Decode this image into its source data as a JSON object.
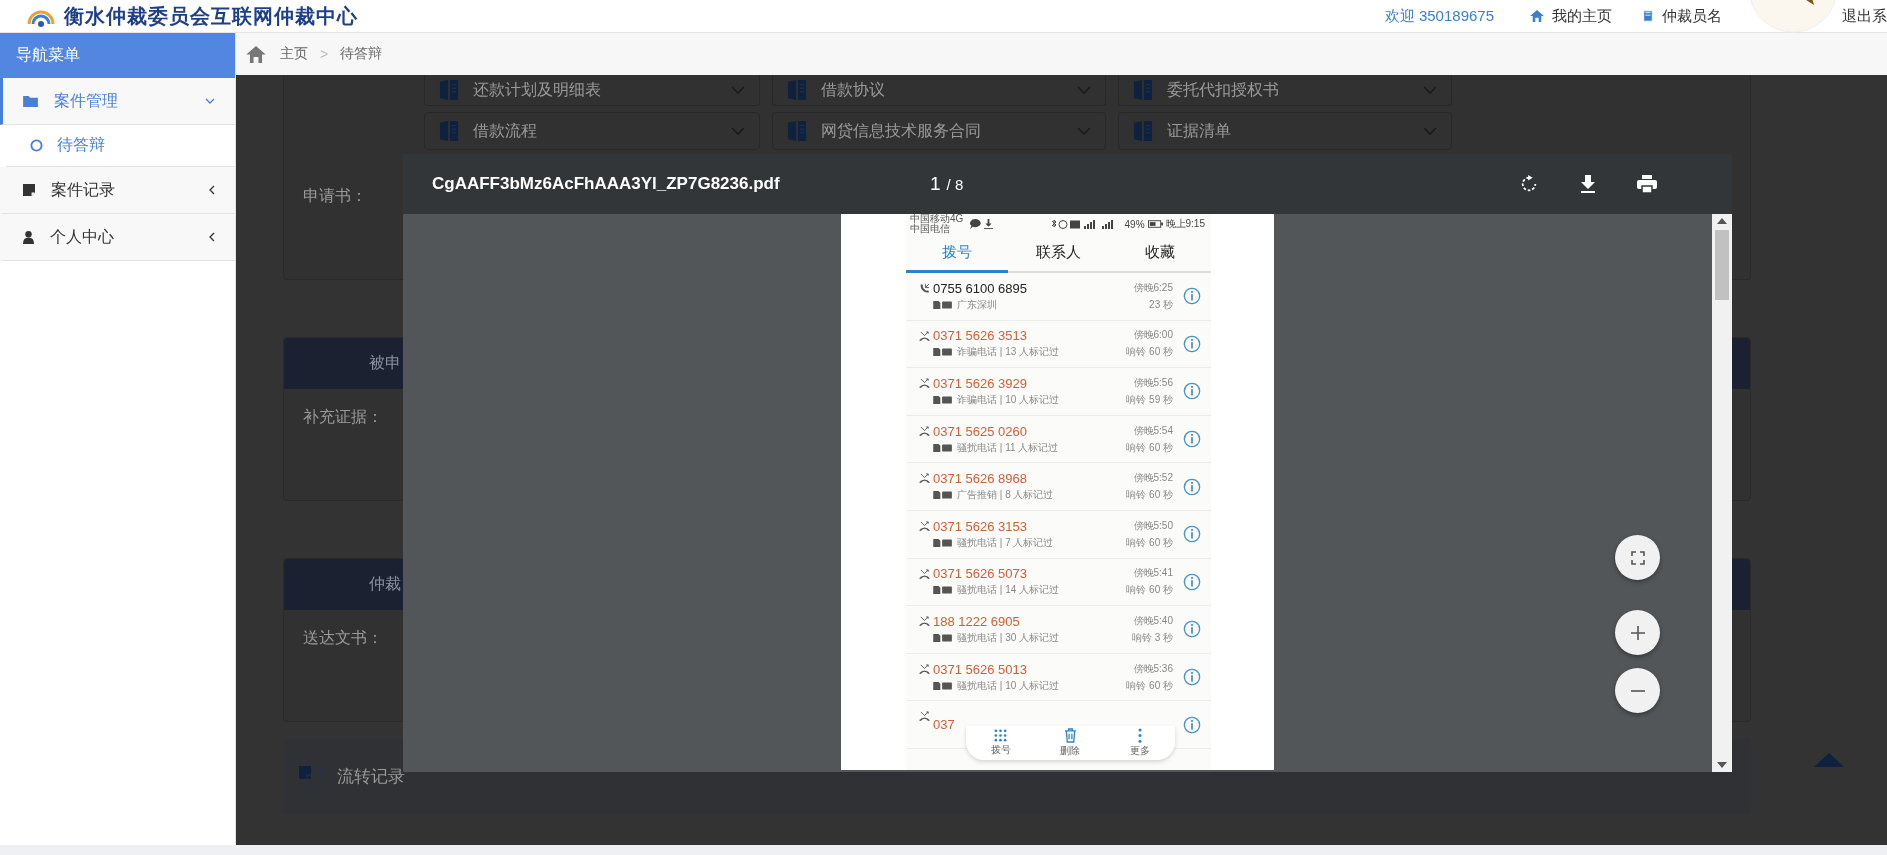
{
  "header": {
    "title": "衡水仲裁委员会互联网仲裁中心",
    "welcome": "欢迎 350189675",
    "links": [
      {
        "kind": "home",
        "label": "我的主页"
      },
      {
        "kind": "book",
        "label": "仲裁员名"
      },
      {
        "kind": "plain",
        "label": "退出系"
      }
    ]
  },
  "sidebar": {
    "title": "导航菜单",
    "items": [
      {
        "kind": "folder",
        "label": "案件管理",
        "selected": true,
        "expanded": true,
        "children": [
          {
            "label": "待答辩",
            "selected": true
          }
        ]
      },
      {
        "kind": "note",
        "label": "案件记录",
        "selected": false,
        "expanded": false
      },
      {
        "kind": "user",
        "label": "个人中心",
        "selected": false,
        "expanded": false
      }
    ]
  },
  "breadcrumb": {
    "items": [
      "主页",
      "待答辩"
    ],
    "separator": ">"
  },
  "documents": [
    "还款计划及明细表",
    "借款协议",
    "委托代扣授权书",
    "借款流程",
    "网贷信息技术服务合同",
    "证据清单"
  ],
  "sections": [
    {
      "label": "申请书："
    },
    {
      "heading": "被申",
      "label": "补充证据："
    },
    {
      "heading": "仲裁",
      "label": "送达文书："
    }
  ],
  "flow_record": "流转记录",
  "viewer": {
    "filename": "CgAAFF3bMz6AcFhAAA3Yl_ZP7G8236.pdf",
    "page": "1",
    "page_count": "/ 8"
  },
  "phone": {
    "carriers": [
      "中国移动4G",
      "中国电信"
    ],
    "battery": "49%",
    "time": "晚上9:15",
    "tabs": [
      {
        "label": "拨号",
        "selected": true
      },
      {
        "label": "联系人",
        "selected": false
      },
      {
        "label": "收藏",
        "selected": false
      }
    ],
    "calls": [
      {
        "kind": "answered",
        "number": "0755 6100 6895",
        "note": "广东深圳",
        "time": "傍晚6:25",
        "duration": "23 秒"
      },
      {
        "kind": "missed",
        "number": "0371 5626 3513",
        "note": "诈骗电话 | 13 人标记过",
        "time": "傍晚6:00",
        "duration": "响铃 60 秒"
      },
      {
        "kind": "missed",
        "number": "0371 5626 3929",
        "note": "诈骗电话 | 10 人标记过",
        "time": "傍晚5:56",
        "duration": "响铃 59 秒"
      },
      {
        "kind": "missed",
        "number": "0371 5625 0260",
        "note": "骚扰电话 | 11 人标记过",
        "time": "傍晚5:54",
        "duration": "响铃 60 秒"
      },
      {
        "kind": "missed",
        "number": "0371 5626 8968",
        "note": "广告推销 | 8 人标记过",
        "time": "傍晚5:52",
        "duration": "响铃 60 秒"
      },
      {
        "kind": "missed",
        "number": "0371 5626 3153",
        "note": "骚扰电话 | 7 人标记过",
        "time": "傍晚5:50",
        "duration": "响铃 60 秒"
      },
      {
        "kind": "missed",
        "number": "0371 5626 5073",
        "note": "骚扰电话 | 14 人标记过",
        "time": "傍晚5:41",
        "duration": "响铃 60 秒"
      },
      {
        "kind": "missed",
        "number": "188 1222 6905",
        "note": "骚扰电话 | 30 人标记过",
        "time": "傍晚5:40",
        "duration": "响铃 3 秒"
      },
      {
        "kind": "missed",
        "number": "0371 5626 5013",
        "note": "骚扰电话 | 10 人标记过",
        "time": "傍晚5:36",
        "duration": "响铃 60 秒"
      },
      {
        "kind": "missed",
        "number": "037"
      }
    ],
    "bottom_bar": [
      {
        "kind": "dialpad",
        "label": "拨号"
      },
      {
        "kind": "delete",
        "label": "删除"
      },
      {
        "kind": "more",
        "label": "更多"
      }
    ]
  }
}
